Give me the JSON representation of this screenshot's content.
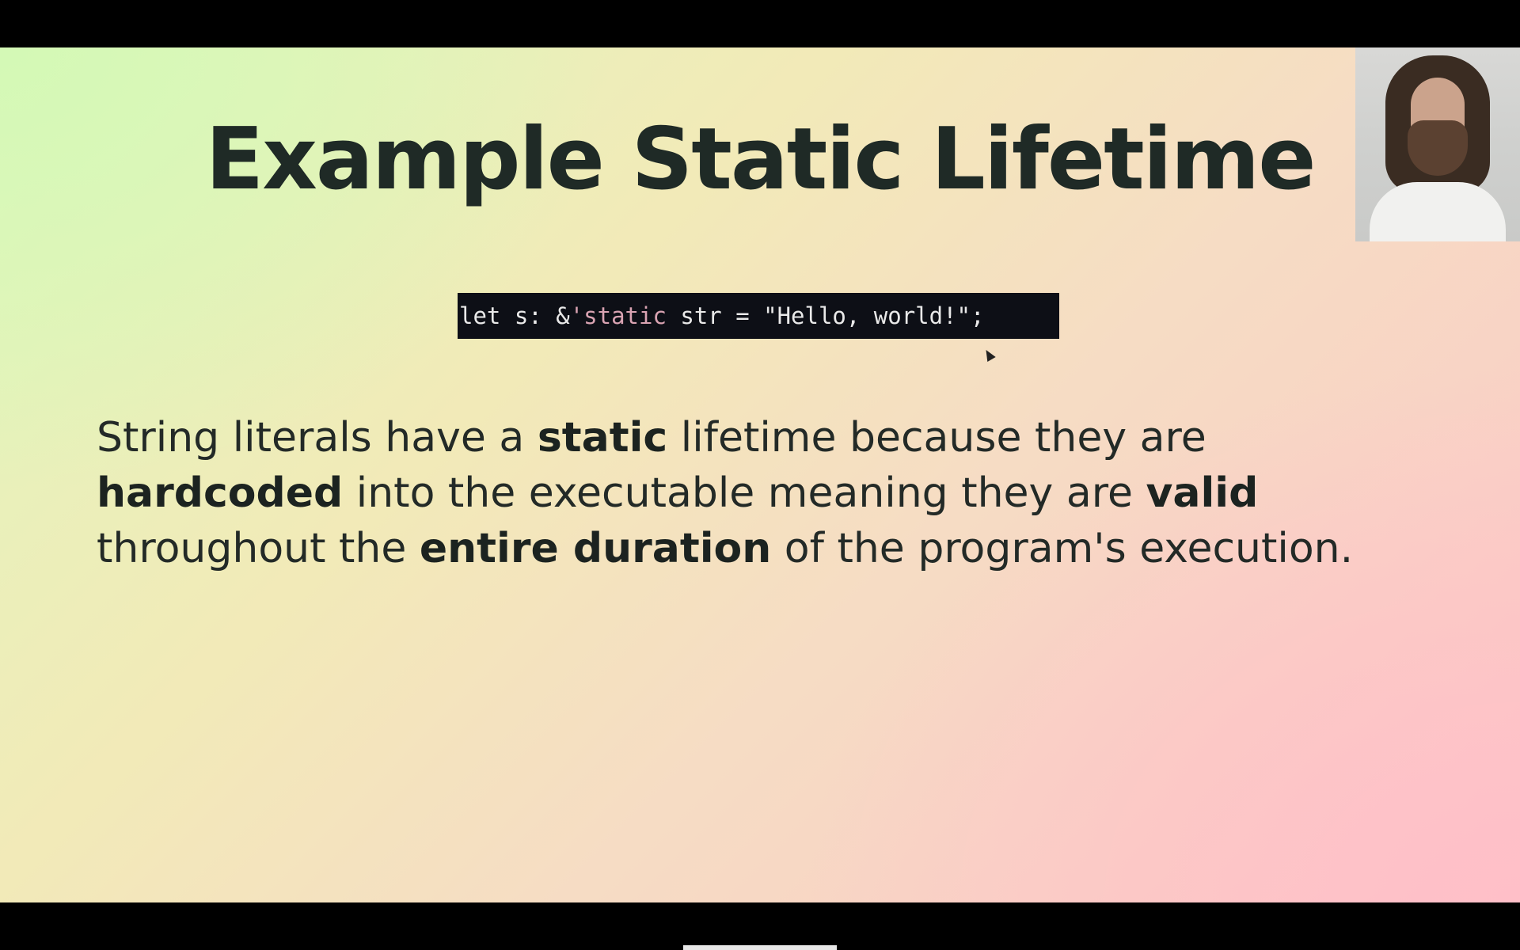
{
  "slide": {
    "title": "Example Static Lifetime",
    "code": {
      "part1": "let s: &",
      "lifetime": "'static",
      "part2": " str = \"Hello, world!\";"
    },
    "body": {
      "t1": "String literals have a ",
      "b1": "static",
      "t2": " lifetime because they are ",
      "b2": "hardcoded",
      "t3": " into the executable meaning they are ",
      "b3": "valid",
      "t4": " throughout the ",
      "b4": "entire duration",
      "t5": " of the program's execution."
    }
  },
  "colors": {
    "gradient_top_left": "#d4f9b6",
    "gradient_bottom_right": "#ffbfc8",
    "code_background": "#0d0f16",
    "title_text": "#1f2a26"
  },
  "icons": {
    "pointer": "mouse-pointer-icon"
  }
}
